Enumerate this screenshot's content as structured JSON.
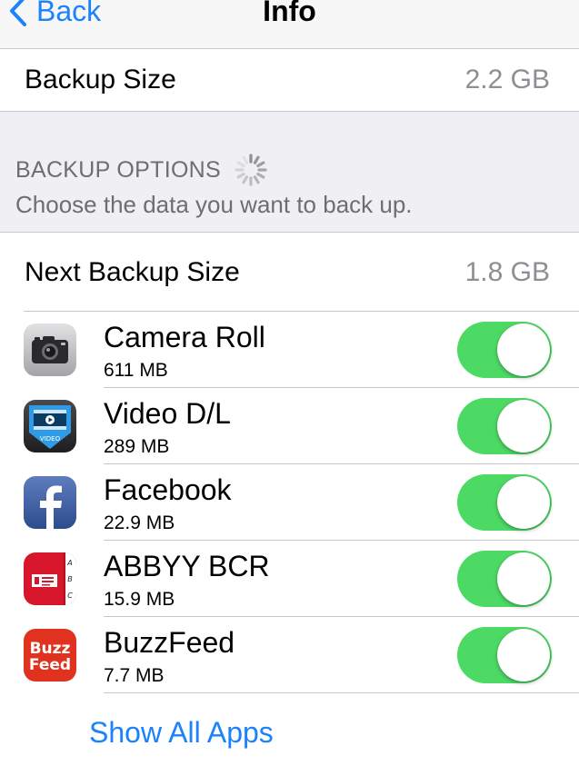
{
  "nav": {
    "back_label": "Back",
    "title": "Info"
  },
  "backup_size": {
    "label": "Backup Size",
    "value": "2.2 GB"
  },
  "backup_options": {
    "header": "BACKUP OPTIONS",
    "footer": "Choose the data you want to back up."
  },
  "next_backup_size": {
    "label": "Next Backup Size",
    "value": "1.8 GB"
  },
  "apps": [
    {
      "name": "Camera Roll",
      "size": "611 MB",
      "icon": "camera-icon",
      "enabled": true
    },
    {
      "name": "Video D/L",
      "size": "289 MB",
      "icon": "video-dl-icon",
      "enabled": true
    },
    {
      "name": "Facebook",
      "size": "22.9 MB",
      "icon": "facebook-icon",
      "enabled": true
    },
    {
      "name": "ABBYY BCR",
      "size": "15.9 MB",
      "icon": "abbyy-bcr-icon",
      "enabled": true
    },
    {
      "name": "BuzzFeed",
      "size": "7.7 MB",
      "icon": "buzzfeed-icon",
      "enabled": true
    }
  ],
  "icon_text": {
    "video": "VIDEO",
    "buzz": "Buzz",
    "feed": "Feed"
  },
  "show_all_label": "Show All Apps",
  "colors": {
    "accent": "#1a82fb",
    "toggle_on": "#4cd964",
    "group_bg": "#efeff4",
    "secondary_text": "#8e8e93"
  }
}
